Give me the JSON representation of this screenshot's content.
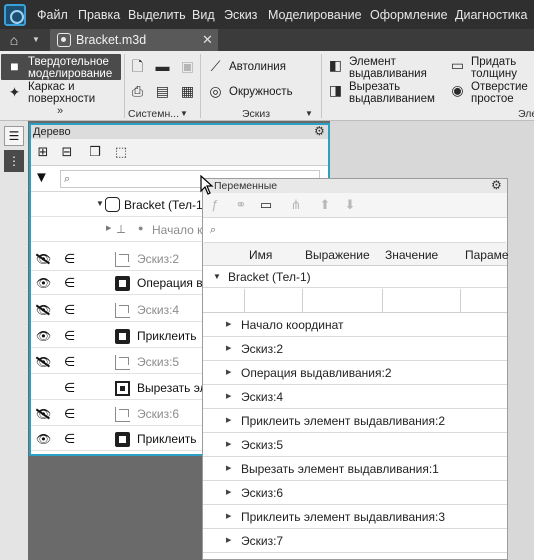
{
  "menu": [
    "Файл",
    "Правка",
    "Выделить",
    "Вид",
    "Эскиз",
    "Моделирование",
    "Оформление",
    "Диагностика"
  ],
  "doc_tab": {
    "title": "Bracket.m3d",
    "close": "✕"
  },
  "ribbon": {
    "modes": [
      {
        "label_line1": "Твердотельное",
        "label_line2": "моделирование"
      },
      {
        "label_line1": "Каркас и",
        "label_line2": "поверхности"
      }
    ],
    "more_glyph": "»",
    "group_system": "Системн...",
    "group_sketch": "Эскиз",
    "group_elements": "Эле",
    "sketch_tools": [
      "Автолиния",
      "Окружность"
    ],
    "elem_tools": [
      {
        "l1": "Элемент",
        "l2": "выдавливания"
      },
      {
        "l1": "Вырезать",
        "l2": "выдавливанием"
      },
      {
        "l1": "Придать",
        "l2": "толщину"
      },
      {
        "l1": "Отверстие",
        "l2": "простое"
      }
    ]
  },
  "tree": {
    "title": "Дерево",
    "search_placeholder": "",
    "root": "Bracket (Тел-1)",
    "origin": "Начало к",
    "rows": [
      {
        "eye": "hidden",
        "type": "sketch",
        "label": "Эскиз:2",
        "muted": true
      },
      {
        "eye": "visible",
        "type": "op",
        "label": "Операция в",
        "muted": false
      },
      {
        "eye": "hidden",
        "type": "sketch",
        "label": "Эскиз:4",
        "muted": true
      },
      {
        "eye": "visible",
        "type": "op",
        "label": "Приклеить",
        "muted": false
      },
      {
        "eye": "hidden",
        "type": "sketch",
        "label": "Эскиз:5",
        "muted": true
      },
      {
        "eye": "none",
        "type": "cut",
        "label": "Вырезать эл",
        "muted": false
      },
      {
        "eye": "hidden",
        "type": "sketch",
        "label": "Эскиз:6",
        "muted": true
      },
      {
        "eye": "visible",
        "type": "op",
        "label": "Приклеить",
        "muted": false
      }
    ]
  },
  "variables": {
    "title": "Переменные",
    "columns": [
      "Имя",
      "Выражение",
      "Значение",
      "Параме"
    ],
    "group": "Bracket (Тел-1)",
    "rows": [
      "Начало координат",
      "Эскиз:2",
      "Операция выдавливания:2",
      "Эскиз:4",
      "Приклеить элемент выдавливания:2",
      "Эскиз:5",
      "Вырезать элемент выдавливания:1",
      "Эскиз:6",
      "Приклеить элемент выдавливания:3",
      "Эскиз:7"
    ]
  },
  "colors": {
    "accent": "#2aa0c4",
    "titlebar": "#2f2f2f",
    "ribbon": "#ececec"
  }
}
